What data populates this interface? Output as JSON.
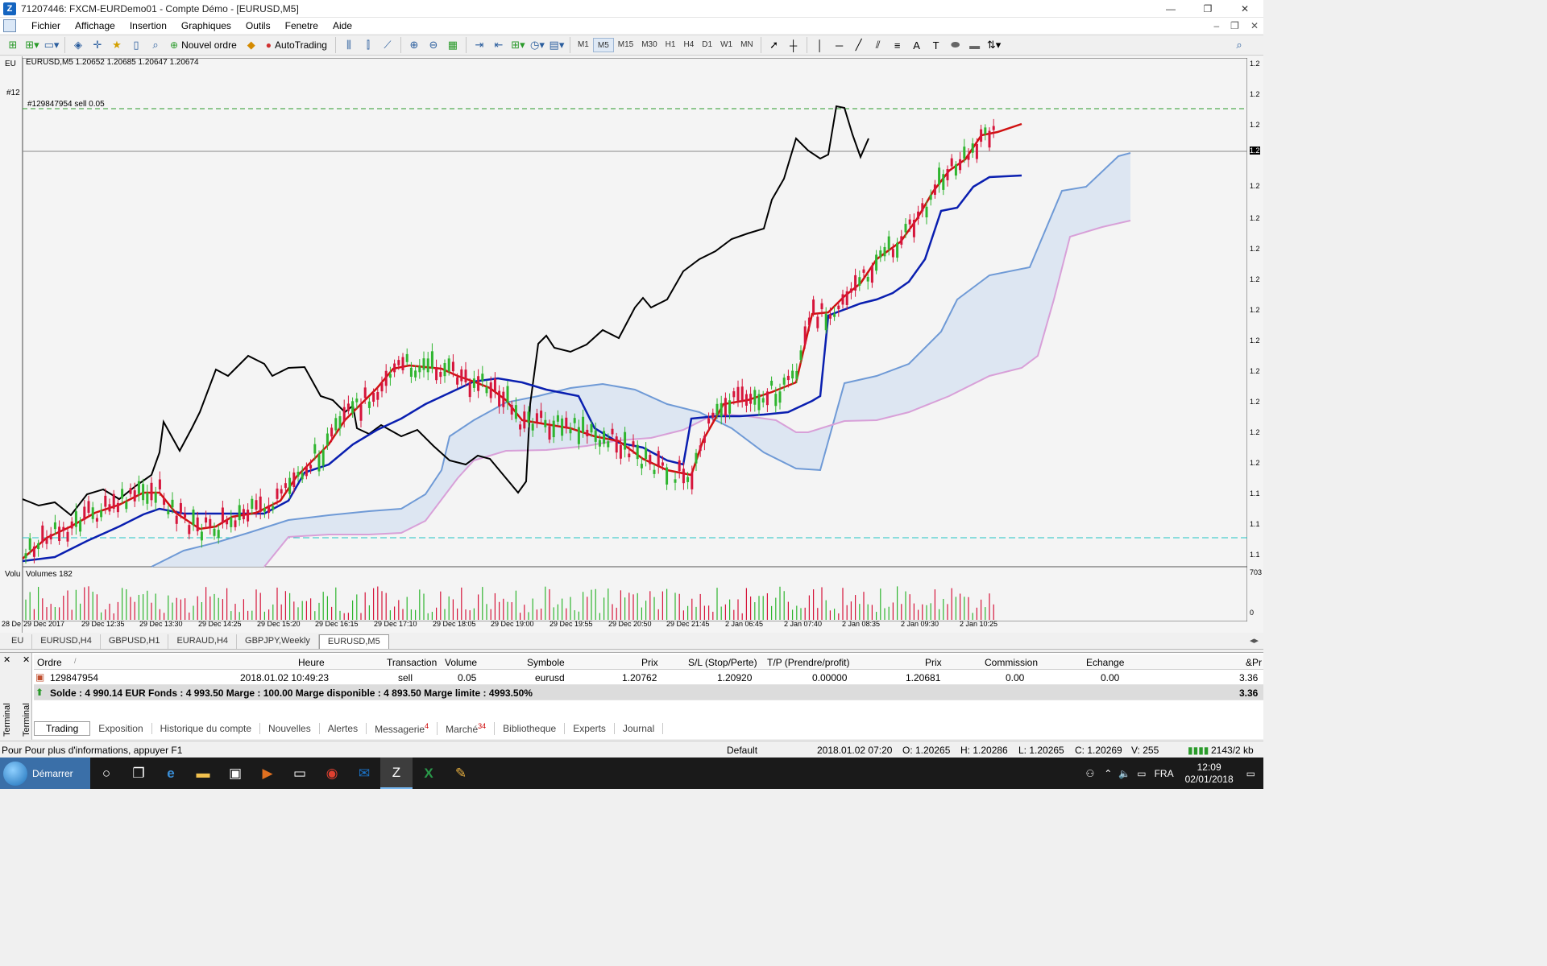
{
  "window": {
    "title": "71207446: FXCM-EURDemo01 - Compte Démo - [EURUSD,M5]",
    "icon_text": "7"
  },
  "menu": [
    "Fichier",
    "Affichage",
    "Insertion",
    "Graphiques",
    "Outils",
    "Fenetre",
    "Aide"
  ],
  "toolbar": {
    "new_order": "Nouvel ordre",
    "autotrading": "AutoTrading",
    "timeframes": [
      "M1",
      "M5",
      "M15",
      "M30",
      "H1",
      "H4",
      "D1",
      "W1",
      "MN"
    ],
    "active_timeframe": "M5"
  },
  "chart": {
    "header": "EURUSD,M5  1.20652 1.20685 1.20647 1.20674",
    "order_line_label": "#129847954 sell 0.05",
    "volumes_label": "Volumes 182",
    "volume_max": "703",
    "volume_min": "0",
    "left_header": "EU",
    "left_order": "#12",
    "left_volume": "Volu",
    "price_labels": [
      "1.2",
      "1.2",
      "1.2",
      "1.2",
      "1.2",
      "1.2",
      "1.2",
      "1.2",
      "1.2",
      "1.2",
      "1.2",
      "1.2",
      "1.2",
      "1.2",
      "1.1",
      "1.1",
      "1.1"
    ],
    "date_labels": [
      "28 De",
      "29 Dec 2017",
      "29 Dec 12:35",
      "29 Dec 13:30",
      "29 Dec 14:25",
      "29 Dec 15:20",
      "29 Dec 16:15",
      "29 Dec 17:10",
      "29 Dec 18:05",
      "29 Dec 19:00",
      "29 Dec 19:55",
      "29 Dec 20:50",
      "29 Dec 21:45",
      "2 Jan 06:45",
      "2 Jan 07:40",
      "2 Jan 08:35",
      "2 Jan 09:30",
      "2 Jan 10:25"
    ]
  },
  "chart_tabs": [
    "EU",
    "EURUSD,H4",
    "GBPUSD,H1",
    "EURAUD,H4",
    "GBPJPY,Weekly",
    "EURUSD,M5"
  ],
  "terminal": {
    "side_label": "Terminal",
    "columns": [
      "Ordre",
      "Heure",
      "Transaction",
      "Volume",
      "Symbole",
      "Prix",
      "S/L (Stop/Perte)",
      "T/P (Prendre/profit)",
      "Prix",
      "Commission",
      "Echange",
      "&Pr"
    ],
    "row": {
      "order": "129847954",
      "time": "2018.01.02 10:49:23",
      "type": "sell",
      "volume": "0.05",
      "symbol": "eurusd",
      "price": "1.20762",
      "sl": "1.20920",
      "tp": "0.00000",
      "current_price": "1.20681",
      "commission": "0.00",
      "swap": "0.00",
      "profit": "3.36"
    },
    "summary": "Solde : 4 990.14 EUR  Fonds : 4 993.50  Marge : 100.00  Marge disponible : 4 893.50  Marge limite : 4993.50%",
    "summary_profit": "3.36",
    "tabs": [
      {
        "label": "Trading",
        "badge": ""
      },
      {
        "label": "Exposition",
        "badge": ""
      },
      {
        "label": "Historique du compte",
        "badge": ""
      },
      {
        "label": "Nouvelles",
        "badge": ""
      },
      {
        "label": "Alertes",
        "badge": ""
      },
      {
        "label": "Messagerie",
        "badge": "4"
      },
      {
        "label": "Marché",
        "badge": "34"
      },
      {
        "label": "Bibliotheque",
        "badge": ""
      },
      {
        "label": "Experts",
        "badge": ""
      },
      {
        "label": "Journal",
        "badge": ""
      }
    ]
  },
  "status": {
    "help": "Pour Pour plus d'informations, appuyer F1",
    "profile": "Default",
    "datetime": "2018.01.02 07:20",
    "open": "O: 1.20265",
    "high": "H: 1.20286",
    "low": "L: 1.20265",
    "close": "C: 1.20269",
    "volume": "V: 255",
    "traffic": "2143/2 kb"
  },
  "taskbar": {
    "start": "Démarrer",
    "language": "FRA",
    "time": "12:09",
    "date": "02/01/2018"
  }
}
